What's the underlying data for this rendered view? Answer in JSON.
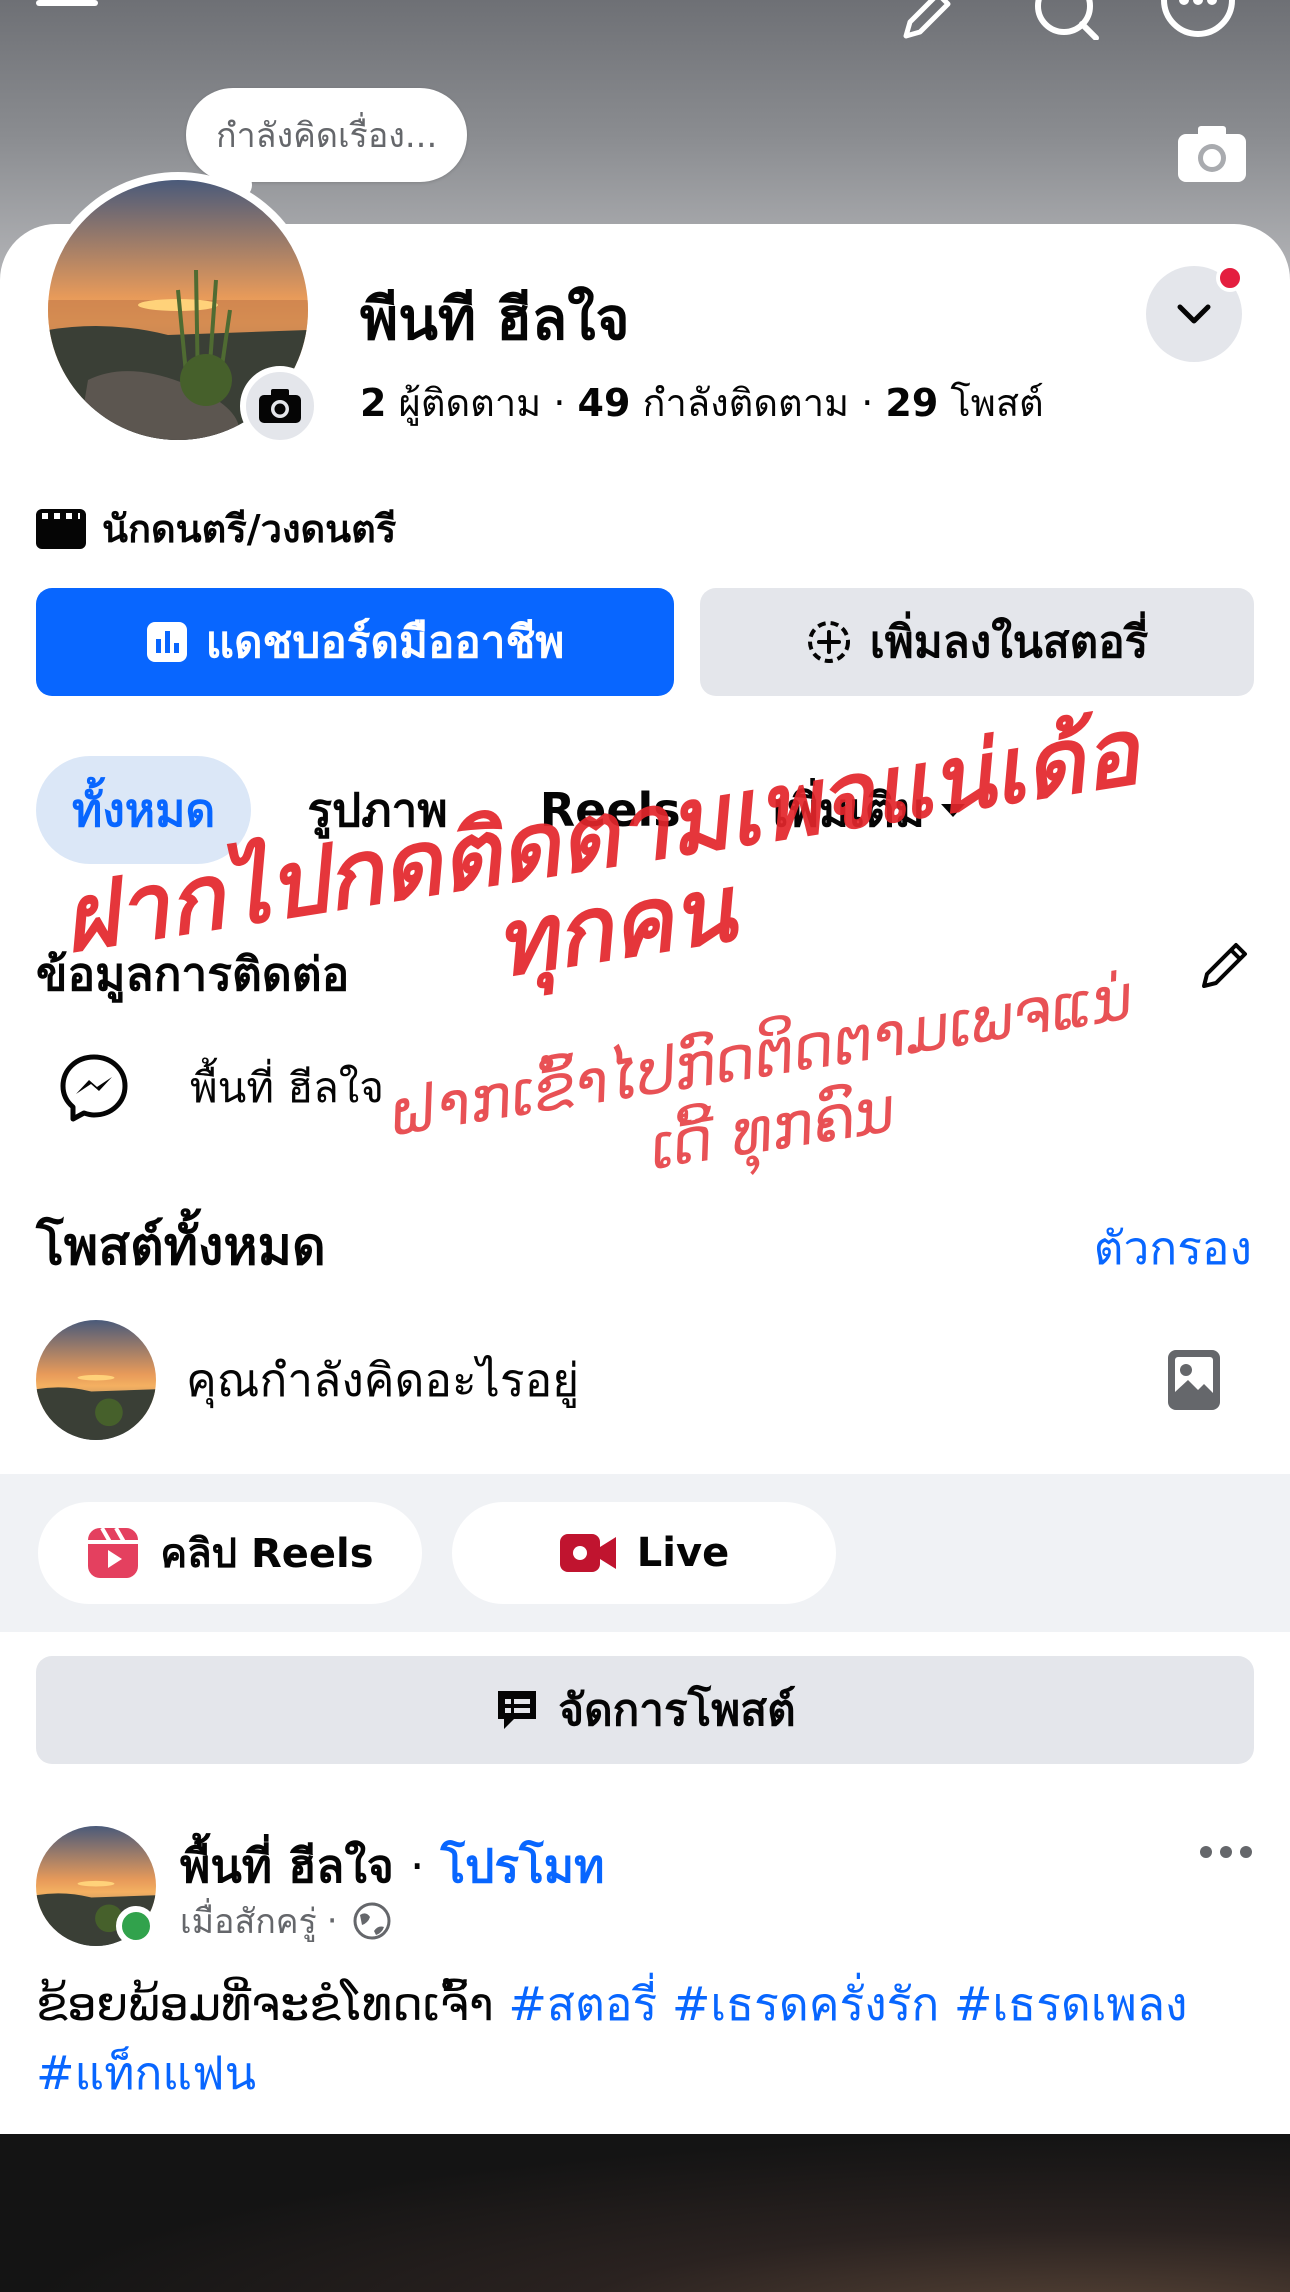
{
  "header": {
    "thought_bubble": "กำลังคิดเรื่อง..."
  },
  "profile": {
    "name": "พีนที ฮีลใจ",
    "followers_count": "2",
    "followers_label": "ผู้ติดตาม",
    "following_count": "49",
    "following_label": "กำลังติดตาม",
    "posts_count": "29",
    "posts_label": "โพสต์",
    "separator": "·",
    "category": "นักดนตรี/วงดนตรี"
  },
  "actions": {
    "dashboard_label": "แดชบอร์ดมืออาชีพ",
    "add_story_label": "เพิ่มลงในสตอรี่"
  },
  "tabs": [
    {
      "label": "ทั้งหมด",
      "active": true
    },
    {
      "label": "รูปภาพ",
      "active": false
    },
    {
      "label": "Reels",
      "active": false
    },
    {
      "label": "เพิ่มเติม",
      "active": false
    }
  ],
  "contact": {
    "title": "ข้อมูลการติดต่อ",
    "messenger_name": "พื้นที่ ฮีลใจ"
  },
  "watermark": {
    "line1": "ฝากไปกดติดตามเพจแน่เด้อทุกคน",
    "line2": "ຝາກເຂົ້າໄປກົດຕິດຕາມເພຈແນ່ເດີ້ ທຸກຄົນ"
  },
  "posts_section": {
    "title": "โพสต์ทั้งหมด",
    "filter_label": "ตัวกรอง",
    "composer_prompt": "คุณกำลังคิดอะไรอยู่",
    "reels_label": "คลิป Reels",
    "live_label": "Live",
    "manage_label": "จัดการโพสต์"
  },
  "post": {
    "author": "พื้นที่ ฮีลใจ",
    "separator": "·",
    "promote_label": "โปรโมท",
    "time": "เมื่อสักครู่",
    "text": "ຂ້ອຍພ້ອມທີ່ຈະຂໍໂທດເຈົ້າ",
    "hashtags": [
      "#สตอรี่",
      "#เธรดครั่งรัก",
      "#เธรดเพลง",
      "#แท็กแฟน"
    ]
  },
  "icons": {
    "menu": "hamburger-menu-icon",
    "edit": "pencil-icon",
    "search": "search-icon",
    "more": "more-icon",
    "camera": "camera-icon",
    "messenger": "messenger-icon",
    "photo": "photo-icon",
    "reels": "reels-icon",
    "live": "live-video-icon",
    "manage": "manage-posts-icon",
    "globe": "globe-icon"
  },
  "colors": {
    "accent": "#0866ff",
    "watermark_red": "#e3262b",
    "online": "#31a24c",
    "reels_red": "#e4405f",
    "live_red": "#c0142f"
  }
}
